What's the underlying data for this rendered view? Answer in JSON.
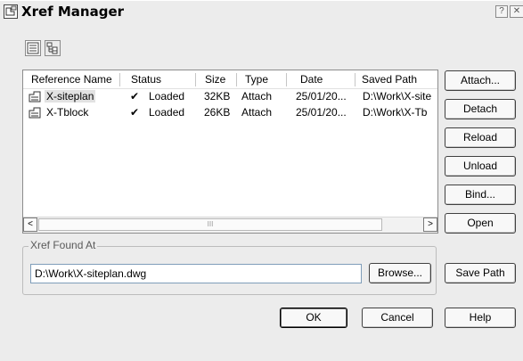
{
  "window": {
    "title": "Xref Manager"
  },
  "titlebar": {
    "help_glyph": "?",
    "close_glyph": "✕"
  },
  "toolbar": {
    "list_view_icon": "list-view-icon",
    "tree_view_icon": "tree-view-icon"
  },
  "table": {
    "columns": [
      "Reference Name",
      "Status",
      "Size",
      "Type",
      "Date",
      "Saved Path"
    ],
    "rows": [
      {
        "name": "X-siteplan",
        "status_mark": "✔",
        "status": "Loaded",
        "size": "32KB",
        "type": "Attach",
        "date": "25/01/20...",
        "path": "D:\\Work\\X-site",
        "selected": true
      },
      {
        "name": "X-Tblock",
        "status_mark": "✔",
        "status": "Loaded",
        "size": "26KB",
        "type": "Attach",
        "date": "25/01/20...",
        "path": "D:\\Work\\X-Tb",
        "selected": false
      }
    ],
    "scroll_left": "<",
    "scroll_right": ">",
    "thumb_grip": "III"
  },
  "side_buttons": {
    "attach": "Attach...",
    "detach": "Detach",
    "reload": "Reload",
    "unload": "Unload",
    "bind": "Bind...",
    "open": "Open"
  },
  "found_at": {
    "label": "Xref Found At",
    "value": "D:\\Work\\X-siteplan.dwg",
    "browse": "Browse...",
    "save_path": "Save Path"
  },
  "footer": {
    "ok": "OK",
    "cancel": "Cancel",
    "help": "Help"
  }
}
